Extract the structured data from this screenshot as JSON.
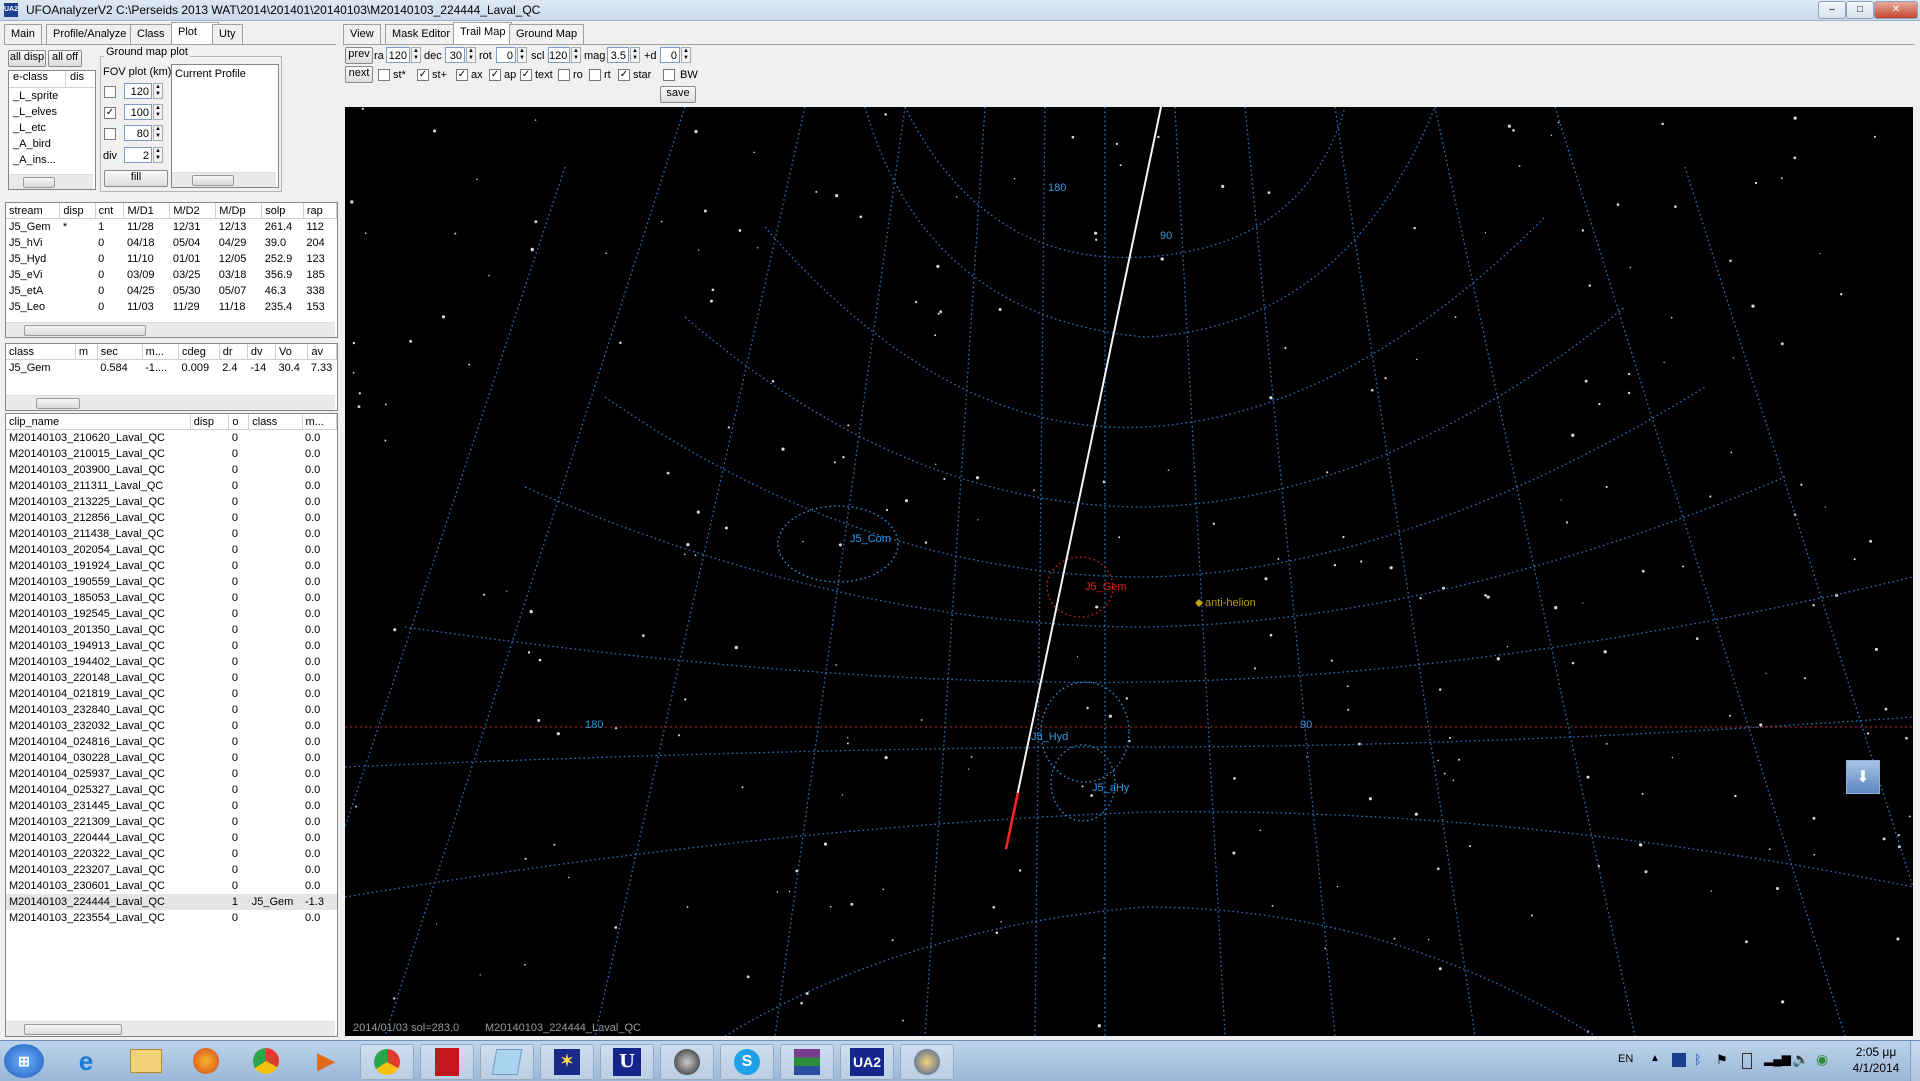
{
  "window": {
    "title": "UFOAnalyzerV2 C:\\Perseids 2013 WAT\\2014\\201401\\20140103\\M20140103_224444_Laval_QC",
    "app_icon": "UA2"
  },
  "left_tabs": [
    "Main",
    "Profile/Analyze",
    "Class",
    "Plot",
    "Uty"
  ],
  "left_active_tab": "Plot",
  "plot_panel": {
    "all_disp": "all disp",
    "all_off": "all off",
    "ground_map_plot": "Ground map plot",
    "fov_plot_label": "FOV plot (km)",
    "fov_rows": [
      {
        "checked": false,
        "value": "120"
      },
      {
        "checked": true,
        "value": "100"
      },
      {
        "checked": false,
        "value": "80"
      }
    ],
    "div_label": "div",
    "div_value": "2",
    "fill_label": "fill",
    "profile_item": "Current Profile",
    "eclass_headers": [
      "e-class",
      "dis"
    ],
    "eclass_items": [
      "_L_sprite",
      "_L_elves",
      "_L_etc",
      "_A_bird",
      "_A_ins..."
    ]
  },
  "stream_table": {
    "headers": [
      "stream",
      "disp",
      "cnt",
      "M/D1",
      "M/D2",
      "M/Dp",
      "solp",
      "rap"
    ],
    "rows": [
      [
        "J5_Gem",
        "*",
        "1",
        "11/28",
        "12/31",
        "12/13",
        "261.4",
        "112"
      ],
      [
        "J5_hVi",
        "",
        "0",
        "04/18",
        "05/04",
        "04/29",
        "39.0",
        "204"
      ],
      [
        "J5_Hyd",
        "",
        "0",
        "11/10",
        "01/01",
        "12/05",
        "252.9",
        "123"
      ],
      [
        "J5_eVi",
        "",
        "0",
        "03/09",
        "03/25",
        "03/18",
        "356.9",
        "185"
      ],
      [
        "J5_etA",
        "",
        "0",
        "04/25",
        "05/30",
        "05/07",
        "46.3",
        "338"
      ],
      [
        "J5_Leo",
        "",
        "0",
        "11/03",
        "11/29",
        "11/18",
        "235.4",
        "153"
      ]
    ]
  },
  "class_table": {
    "headers": [
      "class",
      "m",
      "sec",
      "m...",
      "cdeg",
      "dr",
      "dv",
      "Vo",
      "av"
    ],
    "rows": [
      [
        "J5_Gem",
        "",
        "0.584",
        "-1....",
        "0.009",
        "2.4",
        "-14",
        "30.4",
        "7.33"
      ]
    ]
  },
  "clip_table": {
    "headers": [
      "clip_name",
      "disp",
      "o",
      "class",
      "m..."
    ],
    "rows": [
      [
        "M20140103_210620_Laval_QC",
        "",
        "0",
        "",
        "0.0"
      ],
      [
        "M20140103_210015_Laval_QC",
        "",
        "0",
        "",
        "0.0"
      ],
      [
        "M20140103_203900_Laval_QC",
        "",
        "0",
        "",
        "0.0"
      ],
      [
        "M20140103_211311_Laval_QC",
        "",
        "0",
        "",
        "0.0"
      ],
      [
        "M20140103_213225_Laval_QC",
        "",
        "0",
        "",
        "0.0"
      ],
      [
        "M20140103_212856_Laval_QC",
        "",
        "0",
        "",
        "0.0"
      ],
      [
        "M20140103_211438_Laval_QC",
        "",
        "0",
        "",
        "0.0"
      ],
      [
        "M20140103_202054_Laval_QC",
        "",
        "0",
        "",
        "0.0"
      ],
      [
        "M20140103_191924_Laval_QC",
        "",
        "0",
        "",
        "0.0"
      ],
      [
        "M20140103_190559_Laval_QC",
        "",
        "0",
        "",
        "0.0"
      ],
      [
        "M20140103_185053_Laval_QC",
        "",
        "0",
        "",
        "0.0"
      ],
      [
        "M20140103_192545_Laval_QC",
        "",
        "0",
        "",
        "0.0"
      ],
      [
        "M20140103_201350_Laval_QC",
        "",
        "0",
        "",
        "0.0"
      ],
      [
        "M20140103_194913_Laval_QC",
        "",
        "0",
        "",
        "0.0"
      ],
      [
        "M20140103_194402_Laval_QC",
        "",
        "0",
        "",
        "0.0"
      ],
      [
        "M20140103_220148_Laval_QC",
        "",
        "0",
        "",
        "0.0"
      ],
      [
        "M20140104_021819_Laval_QC",
        "",
        "0",
        "",
        "0.0"
      ],
      [
        "M20140103_232840_Laval_QC",
        "",
        "0",
        "",
        "0.0"
      ],
      [
        "M20140103_232032_Laval_QC",
        "",
        "0",
        "",
        "0.0"
      ],
      [
        "M20140104_024816_Laval_QC",
        "",
        "0",
        "",
        "0.0"
      ],
      [
        "M20140104_030228_Laval_QC",
        "",
        "0",
        "",
        "0.0"
      ],
      [
        "M20140104_025937_Laval_QC",
        "",
        "0",
        "",
        "0.0"
      ],
      [
        "M20140104_025327_Laval_QC",
        "",
        "0",
        "",
        "0.0"
      ],
      [
        "M20140103_231445_Laval_QC",
        "",
        "0",
        "",
        "0.0"
      ],
      [
        "M20140103_221309_Laval_QC",
        "",
        "0",
        "",
        "0.0"
      ],
      [
        "M20140103_220444_Laval_QC",
        "",
        "0",
        "",
        "0.0"
      ],
      [
        "M20140103_220322_Laval_QC",
        "",
        "0",
        "",
        "0.0"
      ],
      [
        "M20140103_223207_Laval_QC",
        "",
        "0",
        "",
        "0.0"
      ],
      [
        "M20140103_230601_Laval_QC",
        "",
        "0",
        "",
        "0.0"
      ],
      [
        "M20140103_224444_Laval_QC",
        "",
        "1",
        "J5_Gem",
        "-1.3"
      ],
      [
        "M20140103_223554_Laval_QC",
        "",
        "0",
        "",
        "0.0"
      ]
    ],
    "selected_index": 29
  },
  "right_tabs": [
    "View",
    "Mask Editor",
    "Trail Map",
    "Ground Map"
  ],
  "right_active_tab": "Trail Map",
  "trail_controls": {
    "prev": "prev",
    "next": "next",
    "save": "save",
    "fields": [
      {
        "label": "ra",
        "value": "120"
      },
      {
        "label": "dec",
        "value": "30"
      },
      {
        "label": "rot",
        "value": "0"
      },
      {
        "label": "scl",
        "value": "120"
      },
      {
        "label": "mag",
        "value": "3.5"
      },
      {
        "label": "+d",
        "value": "0"
      }
    ],
    "checks": [
      {
        "label": "st*",
        "checked": false
      },
      {
        "label": "st+",
        "checked": true
      },
      {
        "label": "ax",
        "checked": true
      },
      {
        "label": "ap",
        "checked": true
      },
      {
        "label": "text",
        "checked": true
      },
      {
        "label": "ro",
        "checked": false
      },
      {
        "label": "rt",
        "checked": false
      },
      {
        "label": "star",
        "checked": true
      },
      {
        "label": "BW",
        "checked": false
      }
    ]
  },
  "map": {
    "grid_labels": {
      "top_180": "180",
      "top_90": "90",
      "mid_180": "180",
      "mid_90": "90"
    },
    "radiants": [
      "J5_Com",
      "J5_Gem",
      "J5_Hyd",
      "J5_aHy"
    ],
    "anti_helion": "anti-helion",
    "status_date": "2014/01/03 sol=283.0",
    "status_clip": "M20140103_224444_Laval_QC",
    "colors": {
      "grid": "#2b78c9",
      "radiant_active": "#e02020",
      "radiant": "#2b9be8",
      "anti_helion": "#b89a10"
    }
  },
  "taskbar": {
    "items": [
      "start-orb-icon",
      "ie-icon",
      "explorer-icon",
      "firefox-icon",
      "chrome-icon",
      "media-icon",
      "chrome-icon-2",
      "pdf-icon",
      "notepad-icon",
      "stars-icon",
      "u-icon",
      "camera-icon",
      "skype-icon",
      "winrar-icon",
      "ua2-icon",
      "ufo-capture-icon"
    ],
    "ua2_label": "UA2",
    "u_label": "U",
    "lang": "EN",
    "time": "2:05 μμ",
    "date": "4/1/2014"
  }
}
